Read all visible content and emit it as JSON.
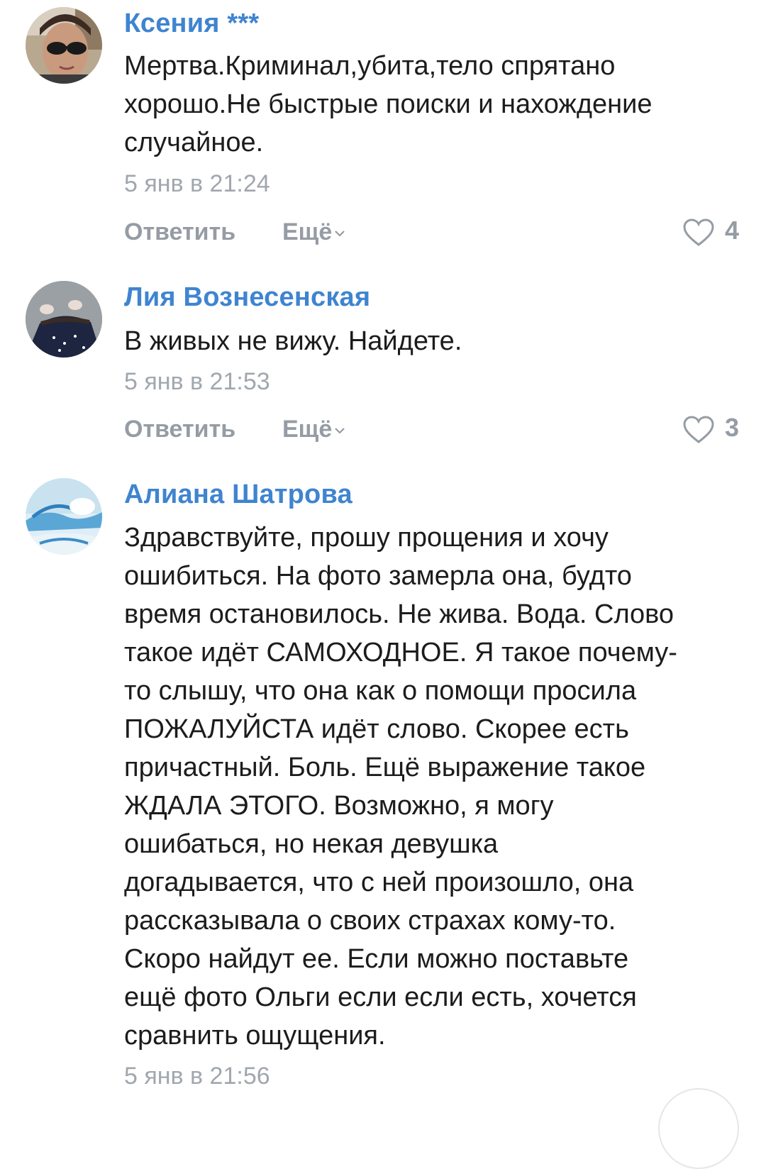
{
  "comments": [
    {
      "author": "Ксения ***",
      "text": "Мертва.Криминал,убита,тело спрятано\nхорошо.Не быстрые поиски и нахождение\nслучайное.",
      "time": "5 янв в 21:24",
      "reply_label": "Ответить",
      "more_label": "Ещё",
      "likes": "4",
      "avatar_icon": "avatar-woman-sunglasses"
    },
    {
      "author": "Лия Вознесенская",
      "text": "В живых не вижу. Найдете.",
      "time": "5 янв в 21:53",
      "reply_label": "Ответить",
      "more_label": "Ещё",
      "likes": "3",
      "avatar_icon": "avatar-feet-photo"
    },
    {
      "author": "Алиана Шатрова",
      "text": "Здравствуйте, прошу прощения и хочу\nошибиться. На фото замерла она, будто\nвремя остановилось. Не жива. Вода. Слово\nтакое идёт САМОХОДНОЕ. Я такое почему-\nто слышу, что она как о помощи просила\nПОЖАЛУЙСТА идёт слово. Скорее есть\nпричастный. Боль. Ещё выражение такое\nЖДАЛА ЭТОГО. Возможно, я могу\nошибаться, но некая девушка\nдогадывается, что с ней произошло, она\nрассказывала о своих страхах кому-то.\nСкоро найдут ее. Если можно поставьте\nещё фото Ольги если если есть, хочется\nсравнить ощущения.",
      "time": "5 янв в 21:56",
      "avatar_icon": "avatar-sky-landscape"
    }
  ],
  "colors": {
    "author": "#3f84d0",
    "text": "#1c1c1c",
    "meta": "#a1a7ae",
    "action": "#959ca4"
  }
}
